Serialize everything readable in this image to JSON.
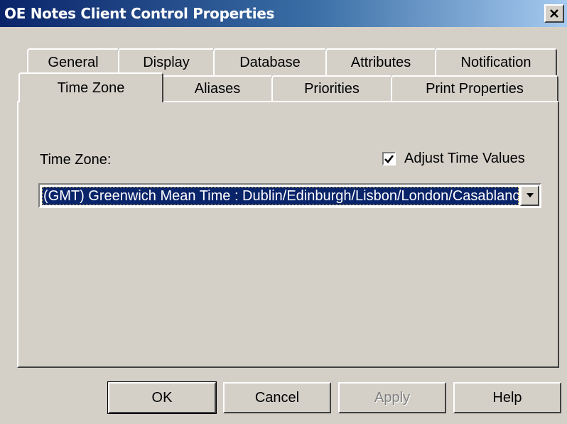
{
  "window": {
    "title": "OE Notes Client Control Properties",
    "close_icon": "close-icon"
  },
  "tabs_row1": [
    {
      "label": "General"
    },
    {
      "label": "Display"
    },
    {
      "label": "Database"
    },
    {
      "label": "Attributes"
    },
    {
      "label": "Notification"
    }
  ],
  "tabs_row2": [
    {
      "label": "Time Zone",
      "active": true
    },
    {
      "label": "Aliases"
    },
    {
      "label": "Priorities"
    },
    {
      "label": "Print Properties"
    }
  ],
  "time_zone": {
    "label": "Time Zone:",
    "adjust_label": "Adjust Time Values",
    "adjust_checked": true,
    "selected_value": "(GMT) Greenwich Mean Time : Dublin/Edinburgh/Lisbon/London/Casablanca, Monrovia"
  },
  "buttons": {
    "ok": "OK",
    "cancel": "Cancel",
    "apply": "Apply",
    "help": "Help"
  },
  "colors": {
    "title_bar_start": "#0a246a",
    "title_bar_end": "#a6caf0",
    "dialog_face": "#d4d0c8",
    "selection": "#0a246a"
  }
}
